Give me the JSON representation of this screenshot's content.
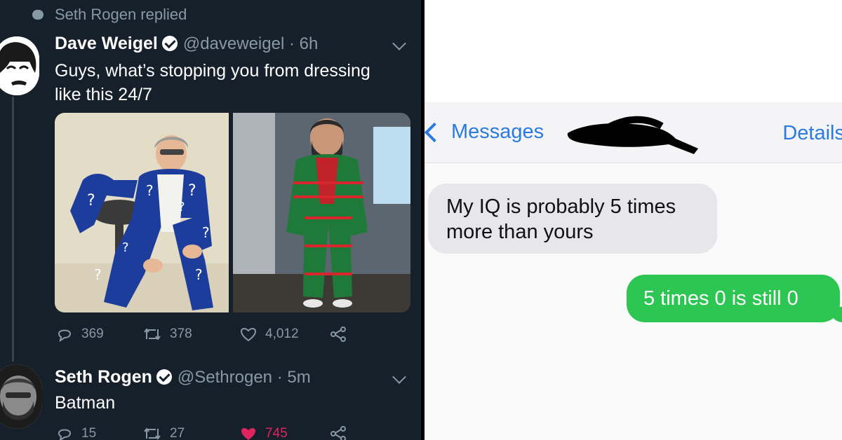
{
  "tweet_panel": {
    "reply_context": "Seth Rogen replied",
    "tweet1": {
      "name": "Dave Weigel",
      "handle": "@daveweigel · 6h",
      "text_line1": "Guys, what’s stopping you from dressing",
      "text_line2": "like this 24/7",
      "replies": "369",
      "retweets": "378",
      "likes": "4,012"
    },
    "tweet2": {
      "name": "Seth Rogen",
      "handle": "@Sethrogen · 5m",
      "text": "Batman",
      "replies": "15",
      "retweets": "27",
      "likes": "745"
    },
    "colors": {
      "background": "#15202b",
      "secondary_text": "#8899a6",
      "like_active": "#e0245e"
    }
  },
  "message_panel": {
    "back_label": "Messages",
    "details_label": "Details",
    "incoming": "My IQ is probably 5 times more than yours",
    "outgoing": "5 times 0 is still 0",
    "colors": {
      "link": "#2a7ae2",
      "incoming_bubble": "#e6e6eb",
      "outgoing_bubble": "#2ec653"
    }
  }
}
